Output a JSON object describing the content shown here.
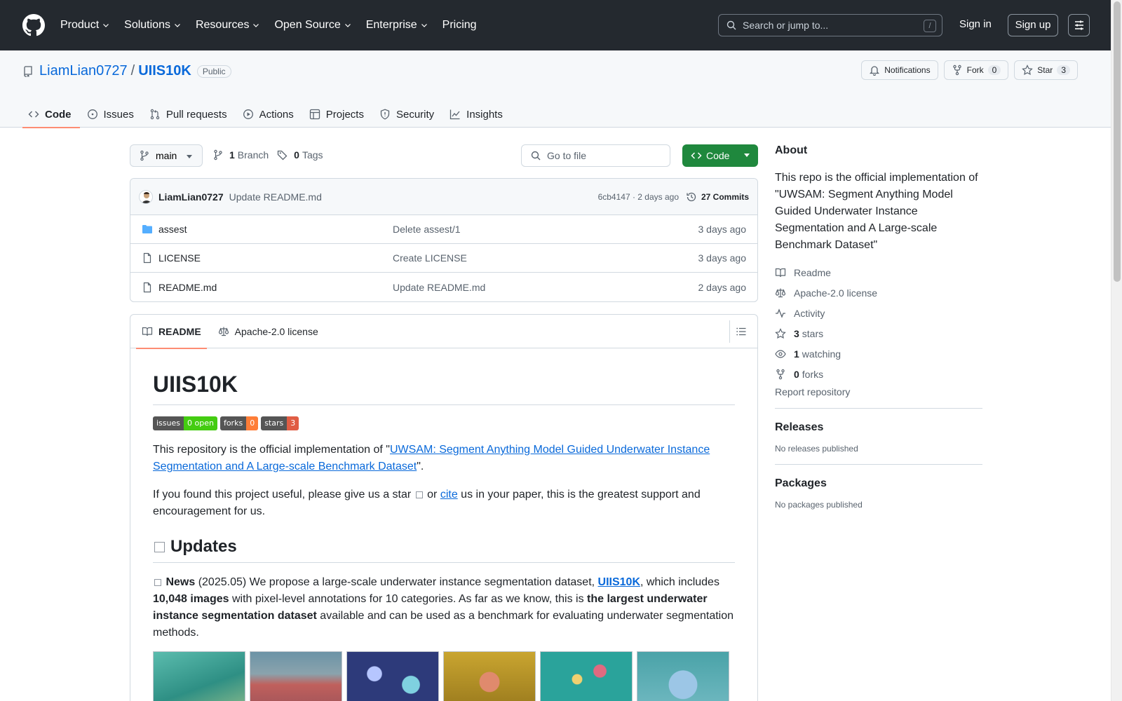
{
  "header": {
    "nav": [
      {
        "label": "Product",
        "dropdown": true
      },
      {
        "label": "Solutions",
        "dropdown": true
      },
      {
        "label": "Resources",
        "dropdown": true
      },
      {
        "label": "Open Source",
        "dropdown": true
      },
      {
        "label": "Enterprise",
        "dropdown": true
      },
      {
        "label": "Pricing",
        "dropdown": false
      }
    ],
    "search_placeholder": "Search or jump to...",
    "search_shortcut": "/",
    "signin": "Sign in",
    "signup": "Sign up"
  },
  "repo": {
    "owner": "LiamLian0727",
    "separator": "/",
    "name": "UIIS10K",
    "visibility": "Public",
    "notifications_label": "Notifications",
    "fork_label": "Fork",
    "fork_count": "0",
    "star_label": "Star",
    "star_count": "3",
    "tabs": [
      {
        "label": "Code",
        "icon": "code-icon",
        "active": true
      },
      {
        "label": "Issues",
        "icon": "issue-icon",
        "active": false
      },
      {
        "label": "Pull requests",
        "icon": "pull-request-icon",
        "active": false
      },
      {
        "label": "Actions",
        "icon": "play-icon",
        "active": false
      },
      {
        "label": "Projects",
        "icon": "table-icon",
        "active": false
      },
      {
        "label": "Security",
        "icon": "shield-icon",
        "active": false
      },
      {
        "label": "Insights",
        "icon": "graph-icon",
        "active": false
      }
    ]
  },
  "toolbar": {
    "branch": "main",
    "branch_count": "1",
    "branch_label": "Branch",
    "tag_count": "0",
    "tag_label": "Tags",
    "goto_placeholder": "Go to file",
    "code_label": "Code"
  },
  "commit": {
    "author": "LiamLian0727",
    "message": "Update README.md",
    "meta": "6cb4147 · 2 days ago",
    "count": "27 Commits"
  },
  "files": [
    {
      "name": "assest",
      "type": "folder",
      "message": "Delete assest/1",
      "date": "3 days ago"
    },
    {
      "name": "LICENSE",
      "type": "file",
      "message": "Create LICENSE",
      "date": "3 days ago"
    },
    {
      "name": "README.md",
      "type": "file",
      "message": "Update README.md",
      "date": "2 days ago"
    }
  ],
  "readme": {
    "tabs": [
      "README",
      "Apache-2.0 license"
    ],
    "title": "UIIS10K",
    "shields": [
      {
        "label": "issues",
        "value": "0 open",
        "color": "#4c1"
      },
      {
        "label": "forks",
        "value": "0",
        "color": "#fe7d37"
      },
      {
        "label": "stars",
        "value": "3",
        "color": "#e05d44"
      }
    ],
    "p1_before": "This repository is the official implementation of \"",
    "p1_link": "UWSAM: Segment Anything Model Guided Underwater Instance Segmentation and A Large-scale Benchmark Dataset",
    "p1_after": "\".",
    "p2_before": "If you found this project useful, please give us a star",
    "p2_or": "or",
    "p2_link": "cite",
    "p2_after": "us in your paper, this is the greatest support and encouragement for us.",
    "h2": "Updates",
    "news_bold": "News",
    "news_1": "(2025.05) We propose a large-scale underwater instance segmentation dataset,",
    "news_link": "UIIS10K",
    "news_2": ", which includes",
    "news_bold2": "10,048 images",
    "news_3": "with pixel-level annotations for 10 categories. As far as we know, this is",
    "news_bold3": "the largest underwater instance segmentation dataset",
    "news_4": "available and can be used as a benchmark for evaluating underwater segmentation methods."
  },
  "about": {
    "heading": "About",
    "description": "This repo is the official implementation of \"UWSAM: Segment Anything Model Guided Underwater Instance Segmentation and A Large-scale Benchmark Dataset\"",
    "readme": "Readme",
    "license": "Apache-2.0 license",
    "activity": "Activity",
    "stars_count": "3",
    "stars_label": "stars",
    "watching_count": "1",
    "watching_label": "watching",
    "forks_count": "0",
    "forks_label": "forks",
    "report": "Report repository"
  },
  "releases": {
    "heading": "Releases",
    "empty": "No releases published"
  },
  "packages": {
    "heading": "Packages",
    "empty": "No packages published"
  },
  "colors": {
    "header_bg": "#24292f",
    "link": "#0969da",
    "primary_button": "#1f883d",
    "tab_underline": "#fd8c73"
  }
}
